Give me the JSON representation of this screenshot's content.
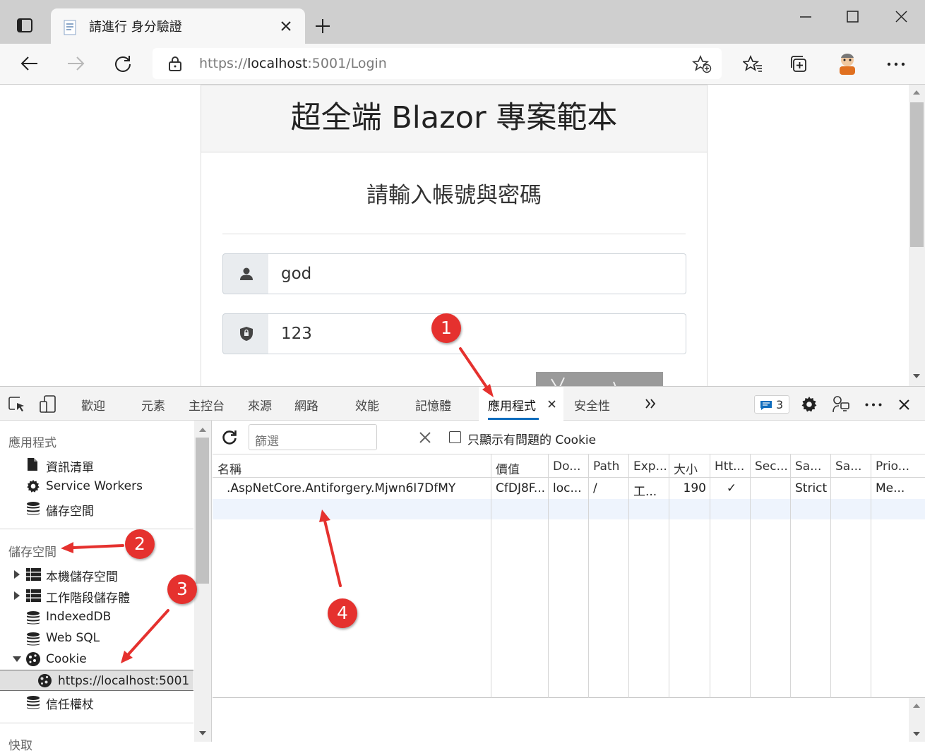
{
  "browser": {
    "tab_title": "請進行 身分驗證",
    "url_scheme": "https://",
    "url_host": "localhost",
    "url_rest": ":5001/Login"
  },
  "page": {
    "header_title": "超全端 Blazor 專案範本",
    "subtitle": "請輸入帳號與密碼",
    "username_value": "god",
    "password_value": "123"
  },
  "devtools": {
    "tabs": [
      "歡迎",
      "元素",
      "主控台",
      "來源",
      "網路",
      "效能",
      "記憶體",
      "應用程式",
      "安全性"
    ],
    "active_tab": "應用程式",
    "issues_count": "3",
    "sidebar": {
      "app_header": "應用程式",
      "app_items": [
        "資訊清單",
        "Service Workers",
        "儲存空間"
      ],
      "storage_header": "儲存空間",
      "storage_items": [
        "本機儲存空間",
        "工作階段儲存體",
        "IndexedDB",
        "Web SQL",
        "Cookie"
      ],
      "cookie_origin": "https://localhost:5001",
      "trust_tokens": "信任權杖",
      "cut_off_header": "快取"
    },
    "filter_placeholder": "篩選",
    "only_issues_label": "只顯示有問題的 Cookie",
    "columns": [
      "名稱",
      "價值",
      "Do...",
      "Path",
      "Exp...",
      "大小",
      "Htt...",
      "Sec...",
      "Sa...",
      "Sa...",
      "Prio..."
    ],
    "cookie_row": {
      "name": ".AspNetCore.Antiforgery.Mjwn6I7DfMY",
      "value": "CfDJ8F...",
      "domain": "loc...",
      "path": "/",
      "expires": "工...",
      "size": "190",
      "httponly": "✓",
      "secure": "",
      "samesite": "Strict",
      "sameparty": "",
      "priority": "Me..."
    }
  },
  "annotations": [
    "1",
    "2",
    "3",
    "4"
  ],
  "colors": {
    "annotation_red": "#e5312e",
    "accent_blue": "#0f6cbd"
  }
}
